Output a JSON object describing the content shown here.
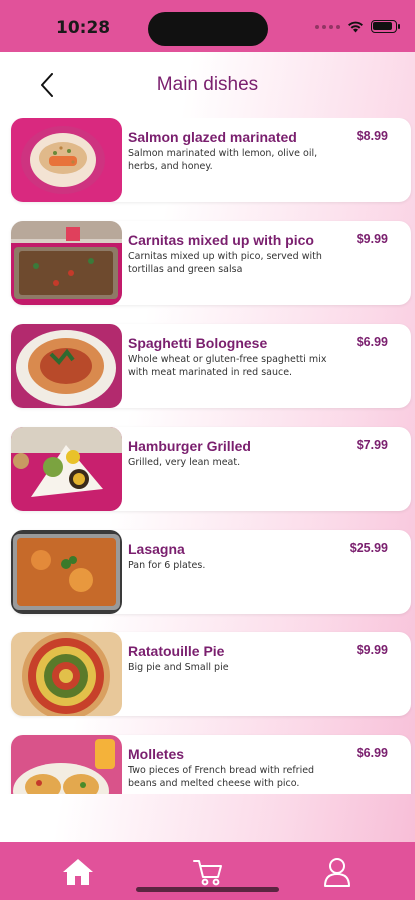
{
  "status": {
    "time": "10:28"
  },
  "header": {
    "title": "Main dishes",
    "back_icon": "chevron-left-icon"
  },
  "dishes": [
    {
      "name": "Salmon glazed marinated",
      "description": "Salmon marinated with lemon, olive oil, herbs, and honey.",
      "price": "$8.99"
    },
    {
      "name": "Carnitas mixed up with pico",
      "description": "Carnitas mixed up with pico, served with tortillas and green salsa",
      "price": "$9.99"
    },
    {
      "name": "Spaghetti Bolognese",
      "description": "Whole wheat or gluten-free spaghetti mix with meat marinated in red sauce.",
      "price": "$6.99"
    },
    {
      "name": "Hamburger Grilled",
      "description": "Grilled, very lean meat.",
      "price": "$7.99"
    },
    {
      "name": "Lasagna",
      "description": "Pan for 6 plates.",
      "price": "$25.99"
    },
    {
      "name": "Ratatouille Pie",
      "description": "Big pie and Small pie",
      "price": "$9.99"
    },
    {
      "name": "Molletes",
      "description": "Two pieces of French bread with refried beans and melted cheese with pico.",
      "price": "$6.99"
    }
  ],
  "tabbar": {
    "items": [
      "home-icon",
      "cart-icon",
      "profile-icon"
    ]
  },
  "colors": {
    "accent": "#e1529a",
    "title": "#7a1f6e"
  }
}
